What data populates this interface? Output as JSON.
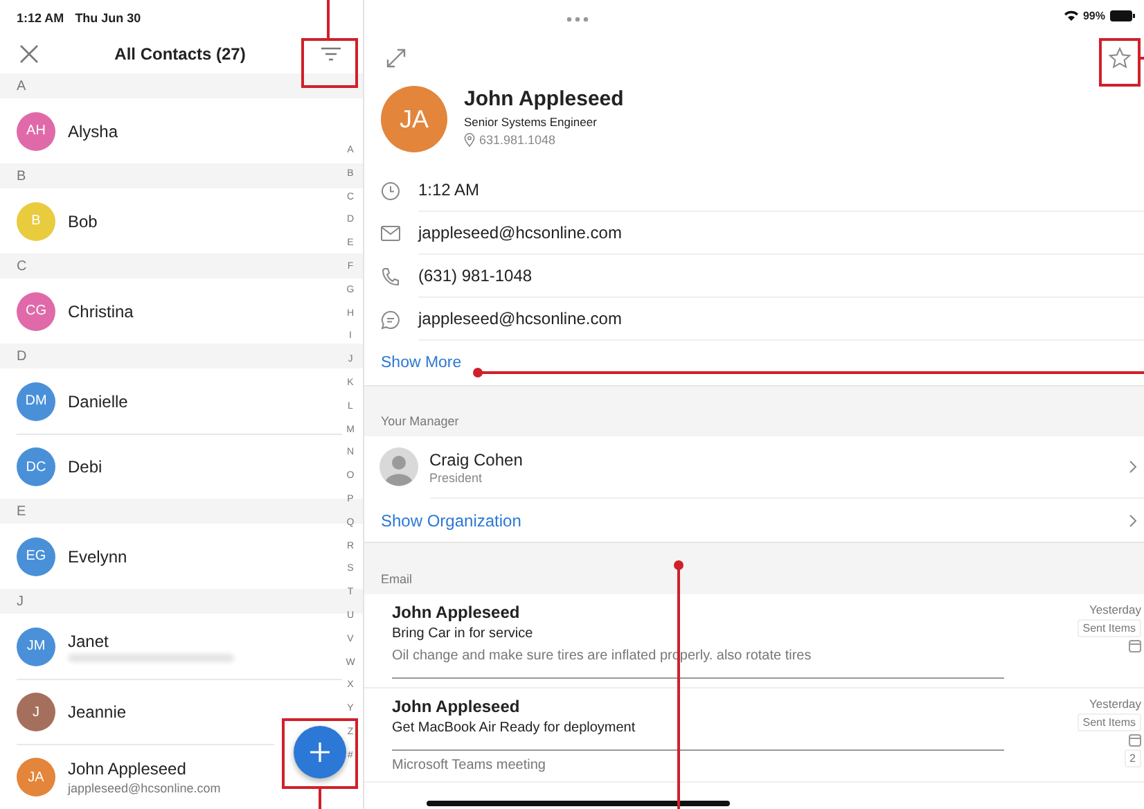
{
  "status_bar": {
    "time": "1:12 AM",
    "date": "Thu Jun 30",
    "battery": "99%"
  },
  "contacts_header": {
    "title": "All Contacts (27)"
  },
  "contact_sections": [
    {
      "letter": "A",
      "contacts": [
        {
          "initials": "AH",
          "name": "Alysha",
          "color": "#e06aa9",
          "blurred_detail": false
        }
      ]
    },
    {
      "letter": "B",
      "contacts": [
        {
          "initials": "B",
          "name": "Bob",
          "color": "#e9cb3e",
          "blurred_detail": false
        }
      ]
    },
    {
      "letter": "C",
      "contacts": [
        {
          "initials": "CG",
          "name": "Christina",
          "color": "#e06aa9",
          "blurred_detail": false
        }
      ]
    },
    {
      "letter": "D",
      "contacts": [
        {
          "initials": "DM",
          "name": "Danielle",
          "color": "#4a90d9",
          "blurred_detail": false
        },
        {
          "initials": "DC",
          "name": "Debi",
          "color": "#4a90d9",
          "blurred_detail": false
        }
      ]
    },
    {
      "letter": "E",
      "contacts": [
        {
          "initials": "EG",
          "name": "Evelynn",
          "color": "#4a90d9",
          "blurred_detail": false
        }
      ]
    },
    {
      "letter": "J",
      "contacts": [
        {
          "initials": "JM",
          "name": "Janet",
          "color": "#4a90d9",
          "blurred_detail": true
        },
        {
          "initials": "J",
          "name": "Jeannie",
          "color": "#a56f5e",
          "blurred_detail": false
        },
        {
          "initials": "JA",
          "name": "John Appleseed",
          "email": "jappleseed@hcsonline.com",
          "color": "#e3853a",
          "blurred_detail": false
        }
      ]
    }
  ],
  "index_letters": [
    "A",
    "B",
    "C",
    "D",
    "E",
    "F",
    "G",
    "H",
    "I",
    "J",
    "K",
    "L",
    "M",
    "N",
    "O",
    "P",
    "Q",
    "R",
    "S",
    "T",
    "U",
    "V",
    "W",
    "X",
    "Y",
    "Z",
    "#"
  ],
  "contact": {
    "initials": "JA",
    "color": "#e3853a",
    "name": "John Appleseed",
    "title": "Senior Systems Engineer",
    "location": "631.981.1048",
    "details": [
      {
        "kind": "time",
        "text": "1:12 AM"
      },
      {
        "kind": "email",
        "text": "jappleseed@hcsonline.com"
      },
      {
        "kind": "phone",
        "text": "(631) 981-1048"
      },
      {
        "kind": "chat",
        "text": "jappleseed@hcsonline.com"
      }
    ],
    "show_more": "Show More"
  },
  "manager": {
    "section": "Your Manager",
    "name": "Craig Cohen",
    "role": "President",
    "show_org": "Show Organization"
  },
  "email": {
    "section": "Email",
    "messages": [
      {
        "kind": "mail",
        "sender": "John Appleseed",
        "subject": "Bring Car in for service",
        "preview": "Oil change and make sure tires are inflated properly. also rotate tires",
        "date": "Yesterday",
        "folder": "Sent Items"
      },
      {
        "kind": "meeting",
        "sender": "John Appleseed",
        "subject": "Get MacBook Air Ready for deployment",
        "preview": "Microsoft Teams meeting",
        "date": "Yesterday",
        "folder": "Sent Items",
        "count": "2"
      }
    ]
  }
}
